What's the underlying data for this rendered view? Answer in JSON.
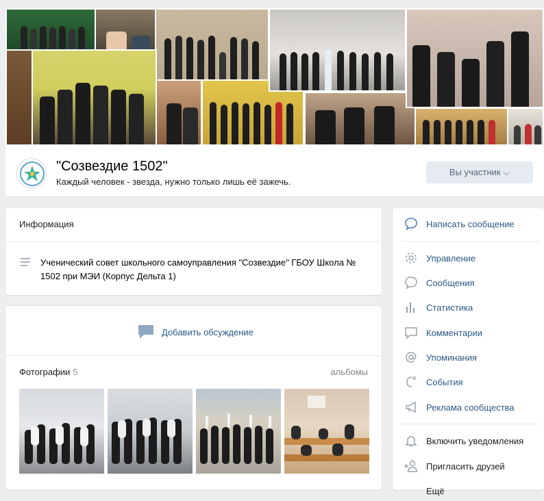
{
  "group": {
    "title": "\"Созвездие 1502\"",
    "status": "Каждый человек - звезда, нужно только лишь её зажечь.",
    "member_button": "Вы участник ⌵"
  },
  "info": {
    "heading": "Информация",
    "description": "Ученический совет школьного самоуправления \"Созвездие\" ГБОУ Школа № 1502 при МЭИ (Корпус Дельта 1)"
  },
  "discussion": {
    "add_label": "Добавить обсуждение"
  },
  "photos": {
    "heading": "Фотографии",
    "count": "5",
    "albums_link": "альбомы"
  },
  "sidebar": {
    "message": "Написать сообщение",
    "items": [
      {
        "label": "Управление",
        "icon": "gear-icon"
      },
      {
        "label": "Сообщения",
        "icon": "chat-bubble-icon"
      },
      {
        "label": "Статистика",
        "icon": "bar-chart-icon"
      },
      {
        "label": "Комментарии",
        "icon": "comment-icon"
      },
      {
        "label": "Упоминания",
        "icon": "at-icon"
      },
      {
        "label": "События",
        "icon": "event-icon"
      },
      {
        "label": "Реклама сообщества",
        "icon": "megaphone-icon"
      }
    ],
    "notifications": "Включить уведомления",
    "invite": "Пригласить друзей",
    "more": "Ещё"
  },
  "colors": {
    "link": "#2a5885",
    "background": "#edeef0",
    "button": "#e5ebf1"
  }
}
